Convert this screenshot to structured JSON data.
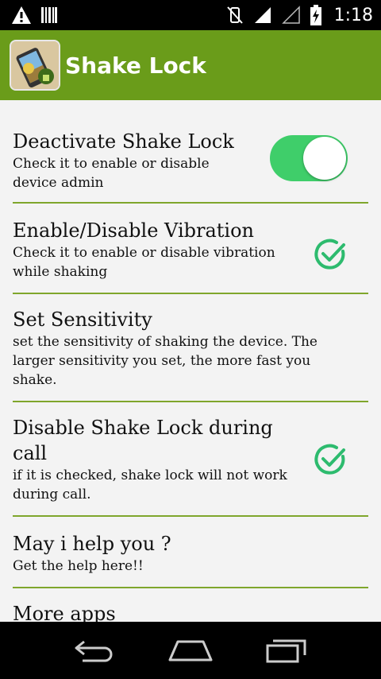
{
  "status_bar": {
    "time": "1:18",
    "icons": [
      "warning-icon",
      "barcode-icon",
      "vibrate-off-icon",
      "cell-signal-icon",
      "wifi-signal-icon",
      "battery-icon"
    ]
  },
  "header": {
    "title": "Shake Lock"
  },
  "settings": [
    {
      "title": "Deactivate Shake Lock",
      "summary": "Check it to enable or disable device admin",
      "control": "toggle",
      "checked": true
    },
    {
      "title": "Enable/Disable Vibration",
      "summary": "Check it to enable or disable vibration while shaking",
      "control": "check",
      "checked": true
    },
    {
      "title": "Set Sensitivity",
      "summary": "set the sensitivity of shaking the device. The larger sensitivity you set, the more fast you shake.",
      "control": "none"
    },
    {
      "title": "Disable Shake Lock during call",
      "summary": "if it is checked, shake lock will not work during call.",
      "control": "check",
      "checked": true
    },
    {
      "title": "May i help you ?",
      "summary": "Get the help here!!",
      "control": "none"
    },
    {
      "title": "More apps",
      "summary": "",
      "control": "none"
    }
  ],
  "nav_bar": {
    "buttons": [
      "back-icon",
      "home-icon",
      "recent-apps-icon"
    ]
  },
  "colors": {
    "action_bar": "#6a9c1a",
    "divider": "#7fa62c",
    "toggle_on": "#3fce6a",
    "check_accent": "#2dbb6e",
    "background": "#f3f3f3"
  }
}
